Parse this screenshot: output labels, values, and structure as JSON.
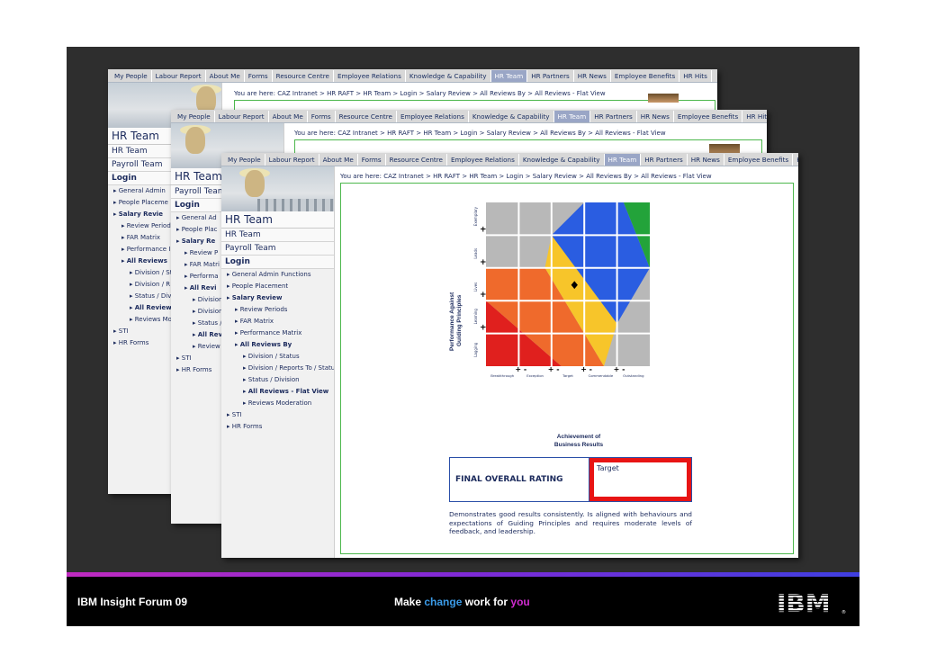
{
  "nav": [
    "My People",
    "Labour Report",
    "About Me",
    "Forms",
    "Resource Centre",
    "Employee Relations",
    "Knowledge & Capability",
    "HR Team",
    "HR Partners",
    "HR News",
    "Employee Benefits",
    "HR Hits"
  ],
  "breadcrumb": "You are here:  CAZ Intranet > HR RAFT > HR Team > Login > Salary Review > All Reviews By > All Reviews - Flat View",
  "sidebar": {
    "title1": "HR Team",
    "title2": "HR Team",
    "title3": "Payroll Team",
    "login": "Login",
    "items": [
      "General Admin Functions",
      "People Placement",
      "Salary Review",
      "Review Periods",
      "FAR Matrix",
      "Performance Matrix",
      "All Reviews By",
      "Division / Status",
      "Division / Reports To / Status",
      "Status / Division",
      "All Reviews - Flat View",
      "Reviews Moderation",
      "STI",
      "HR Forms"
    ]
  },
  "w1side": [
    "General Admin",
    "People Placeme",
    "Salary Revie",
    "Review Period",
    "FAR Matrix",
    "Performance I",
    "All Reviews",
    "Division / St",
    "Division / R",
    "Status / Divi",
    "All Review",
    "Reviews Mo",
    "STI",
    "HR Forms"
  ],
  "w2side": [
    "General Ad",
    "People Plac",
    "Salary Re",
    "Review P",
    "FAR Matri",
    "Performa",
    "All Revi",
    "Division",
    "Division",
    "Status /",
    "All Rev",
    "Review",
    "STI",
    "HR Forms"
  ],
  "matrix": {
    "yaxis": "Performance Against Guiding Principles",
    "xaxis": "Achievement of Business Results",
    "ylabels": [
      "Exemplary",
      "Leads",
      "Lives",
      "Learning",
      "Lagging"
    ],
    "xlabels": [
      "Breakthrough",
      "Exception",
      "Target",
      "Commendable",
      "Outstanding"
    ],
    "colors": {
      "red": "#e0201e",
      "orange": "#ef6a2c",
      "yellow": "#f7c52a",
      "blue": "#2a5de1",
      "green": "#23a33a",
      "gray": "#b8b8b8"
    },
    "marker": "diamond"
  },
  "rating": {
    "label": "FINAL OVERALL RATING",
    "value": "Target"
  },
  "description": "Demonstrates good results consistently. Is aligned with behaviours and expectations of Guiding Principles and requires moderate levels of feedback, and leadership.",
  "footer": {
    "left": "IBM Insight Forum 09",
    "make": "Make",
    "change": "change",
    "work": "work for",
    "you": "you",
    "logo": "IBM"
  }
}
